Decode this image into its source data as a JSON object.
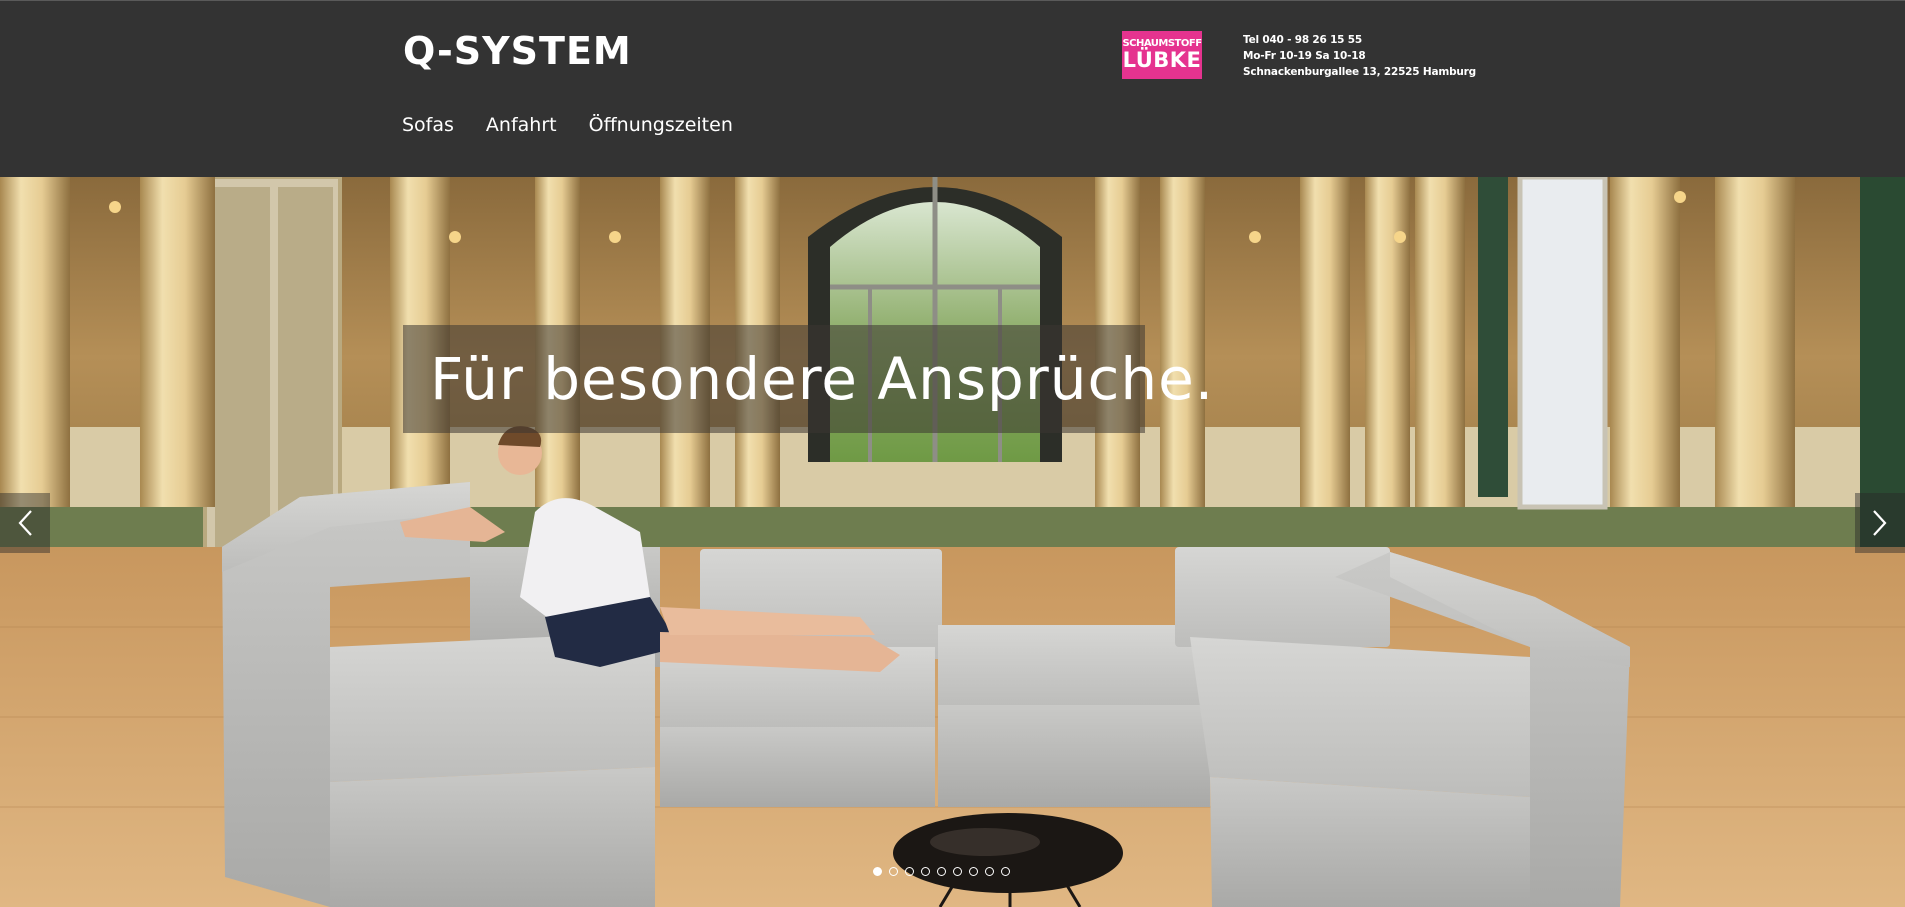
{
  "header": {
    "logo_text": "Q-SYSTEM",
    "partner_logo": {
      "line1": "SCHAUMSTOFF",
      "line2": "LÜBKE",
      "color": "#e5338f"
    },
    "contact": {
      "phone": "Tel 040 - 98 26 15 55",
      "hours": "Mo-Fr 10-19 Sa 10-18",
      "address": "Schnackenburgallee 13, 22525 Hamburg"
    },
    "nav": {
      "items": [
        {
          "label": "Sofas"
        },
        {
          "label": "Anfahrt"
        },
        {
          "label": "Öffnungszeiten"
        }
      ]
    }
  },
  "slider": {
    "caption": "Für besondere Ansprüche.",
    "prev_icon": "chevron-left-icon",
    "next_icon": "chevron-right-icon",
    "slide_count": 9,
    "active_slide": 1
  },
  "colors": {
    "header_background": "#333333",
    "accent": "#e5338f",
    "text": "#ffffff"
  }
}
